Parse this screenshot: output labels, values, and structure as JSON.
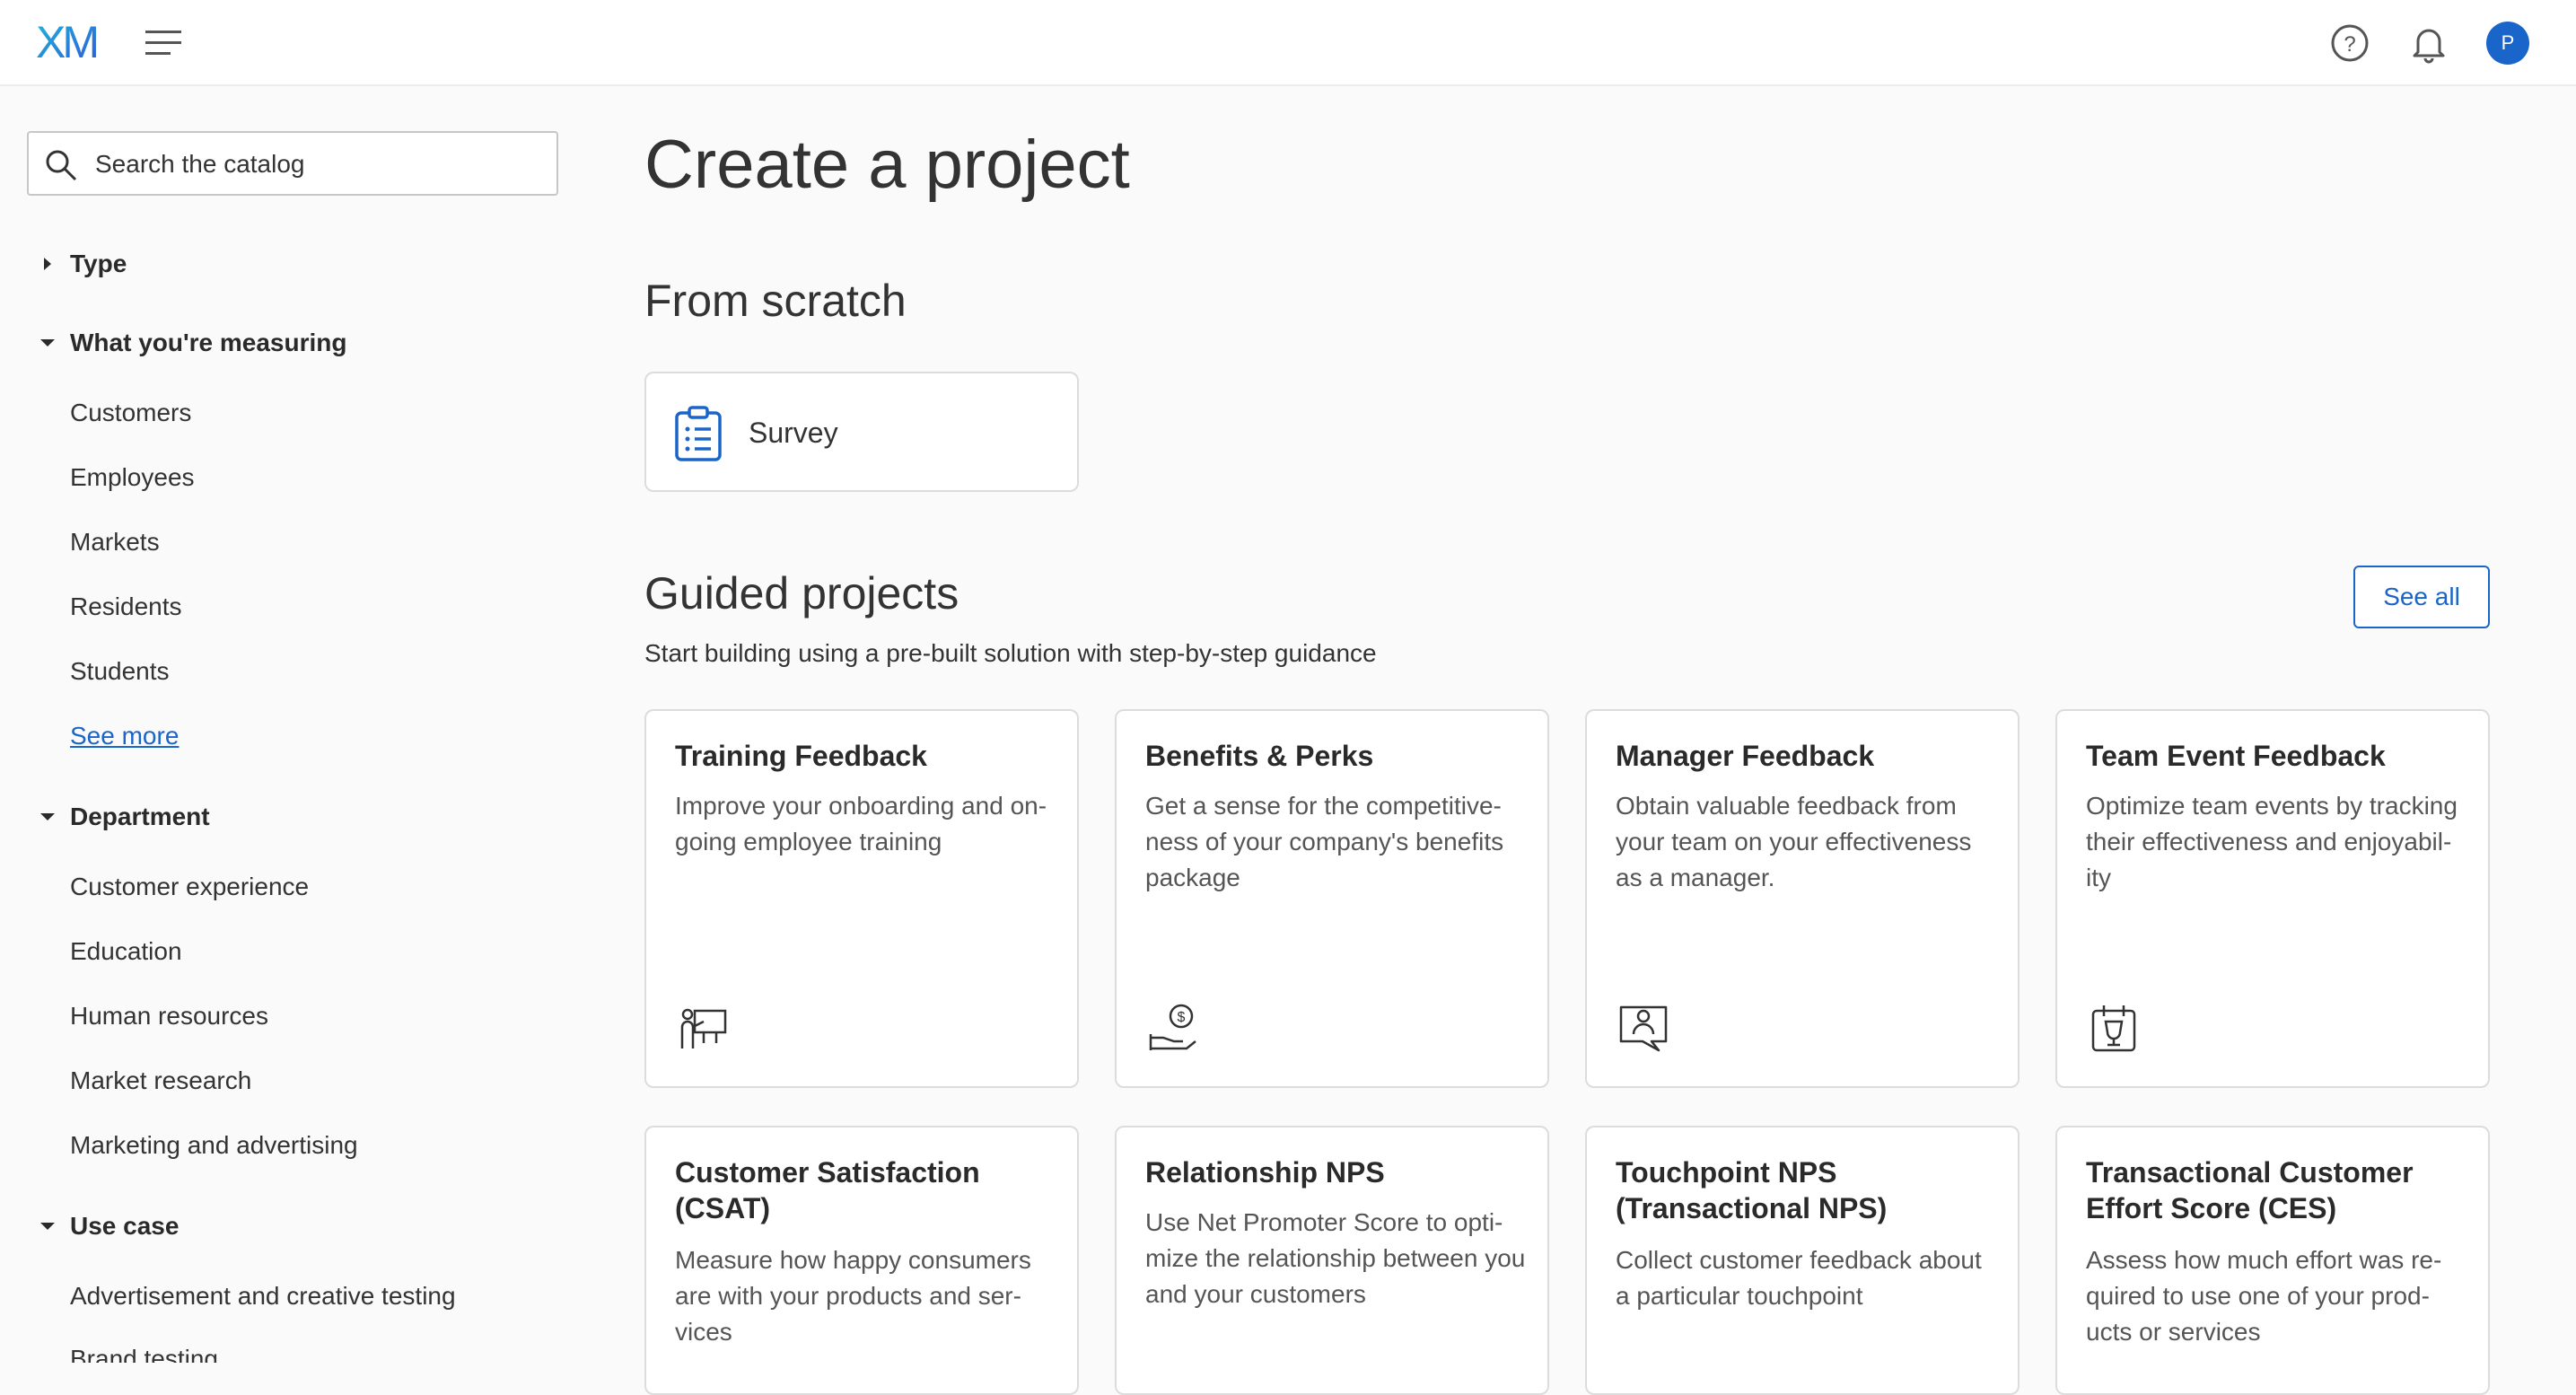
{
  "header": {
    "logo_text": "XM",
    "colors": {
      "accent": "#1a65c9",
      "logo_gradient": [
        "#21b7d8",
        "#2c5ad8"
      ]
    },
    "icons": [
      "menu-icon",
      "help-icon",
      "bell-icon"
    ],
    "avatar_initial": "P"
  },
  "sidebar": {
    "search_placeholder": "Search the catalog",
    "sections": [
      {
        "label": "Type",
        "expanded": false,
        "items": []
      },
      {
        "label": "What you're measuring",
        "expanded": true,
        "items": [
          "Customers",
          "Employees",
          "Markets",
          "Residents",
          "Students"
        ],
        "see_more": "See more"
      },
      {
        "label": "Department",
        "expanded": true,
        "items": [
          "Customer experience",
          "Education",
          "Human resources",
          "Market research",
          "Marketing and advertising"
        ]
      },
      {
        "label": "Use case",
        "expanded": true,
        "items": [
          "Advertisement and creative testing",
          "Brand testing"
        ]
      }
    ]
  },
  "main": {
    "title": "Create a project",
    "from_scratch": {
      "title": "From scratch",
      "survey_label": "Survey"
    },
    "guided": {
      "title": "Guided projects",
      "subtitle": "Start building using a pre-built solution with step-by-step guidance",
      "see_all": "See all",
      "cards": [
        {
          "title": "Training Feedback",
          "desc": "Improve your onboarding and on-going employee training",
          "icon": "training-icon"
        },
        {
          "title": "Benefits & Perks",
          "desc": "Get a sense for the competitive-ness of your company's benefits package",
          "icon": "benefits-icon"
        },
        {
          "title": "Manager Feedback",
          "desc": "Obtain valuable feedback from your team on your effectiveness as a manager.",
          "icon": "manager-icon"
        },
        {
          "title": "Team Event Feedback",
          "desc": "Optimize team events by tracking their effectiveness and enjoyabil-ity",
          "icon": "team-event-icon"
        },
        {
          "title": "Customer Satisfaction (CSAT)",
          "desc": "Measure how happy consumers are with your products and ser-vices"
        },
        {
          "title": "Relationship NPS",
          "desc": "Use Net Promoter Score to opti-mize the relationship between you and your customers"
        },
        {
          "title": "Touchpoint NPS (Transactional NPS)",
          "desc": "Collect customer feedback about a particular touchpoint"
        },
        {
          "title": "Transactional Customer Effort Score (CES)",
          "desc": "Assess how much effort was re-quired to use one of your prod-ucts or services"
        }
      ]
    }
  }
}
